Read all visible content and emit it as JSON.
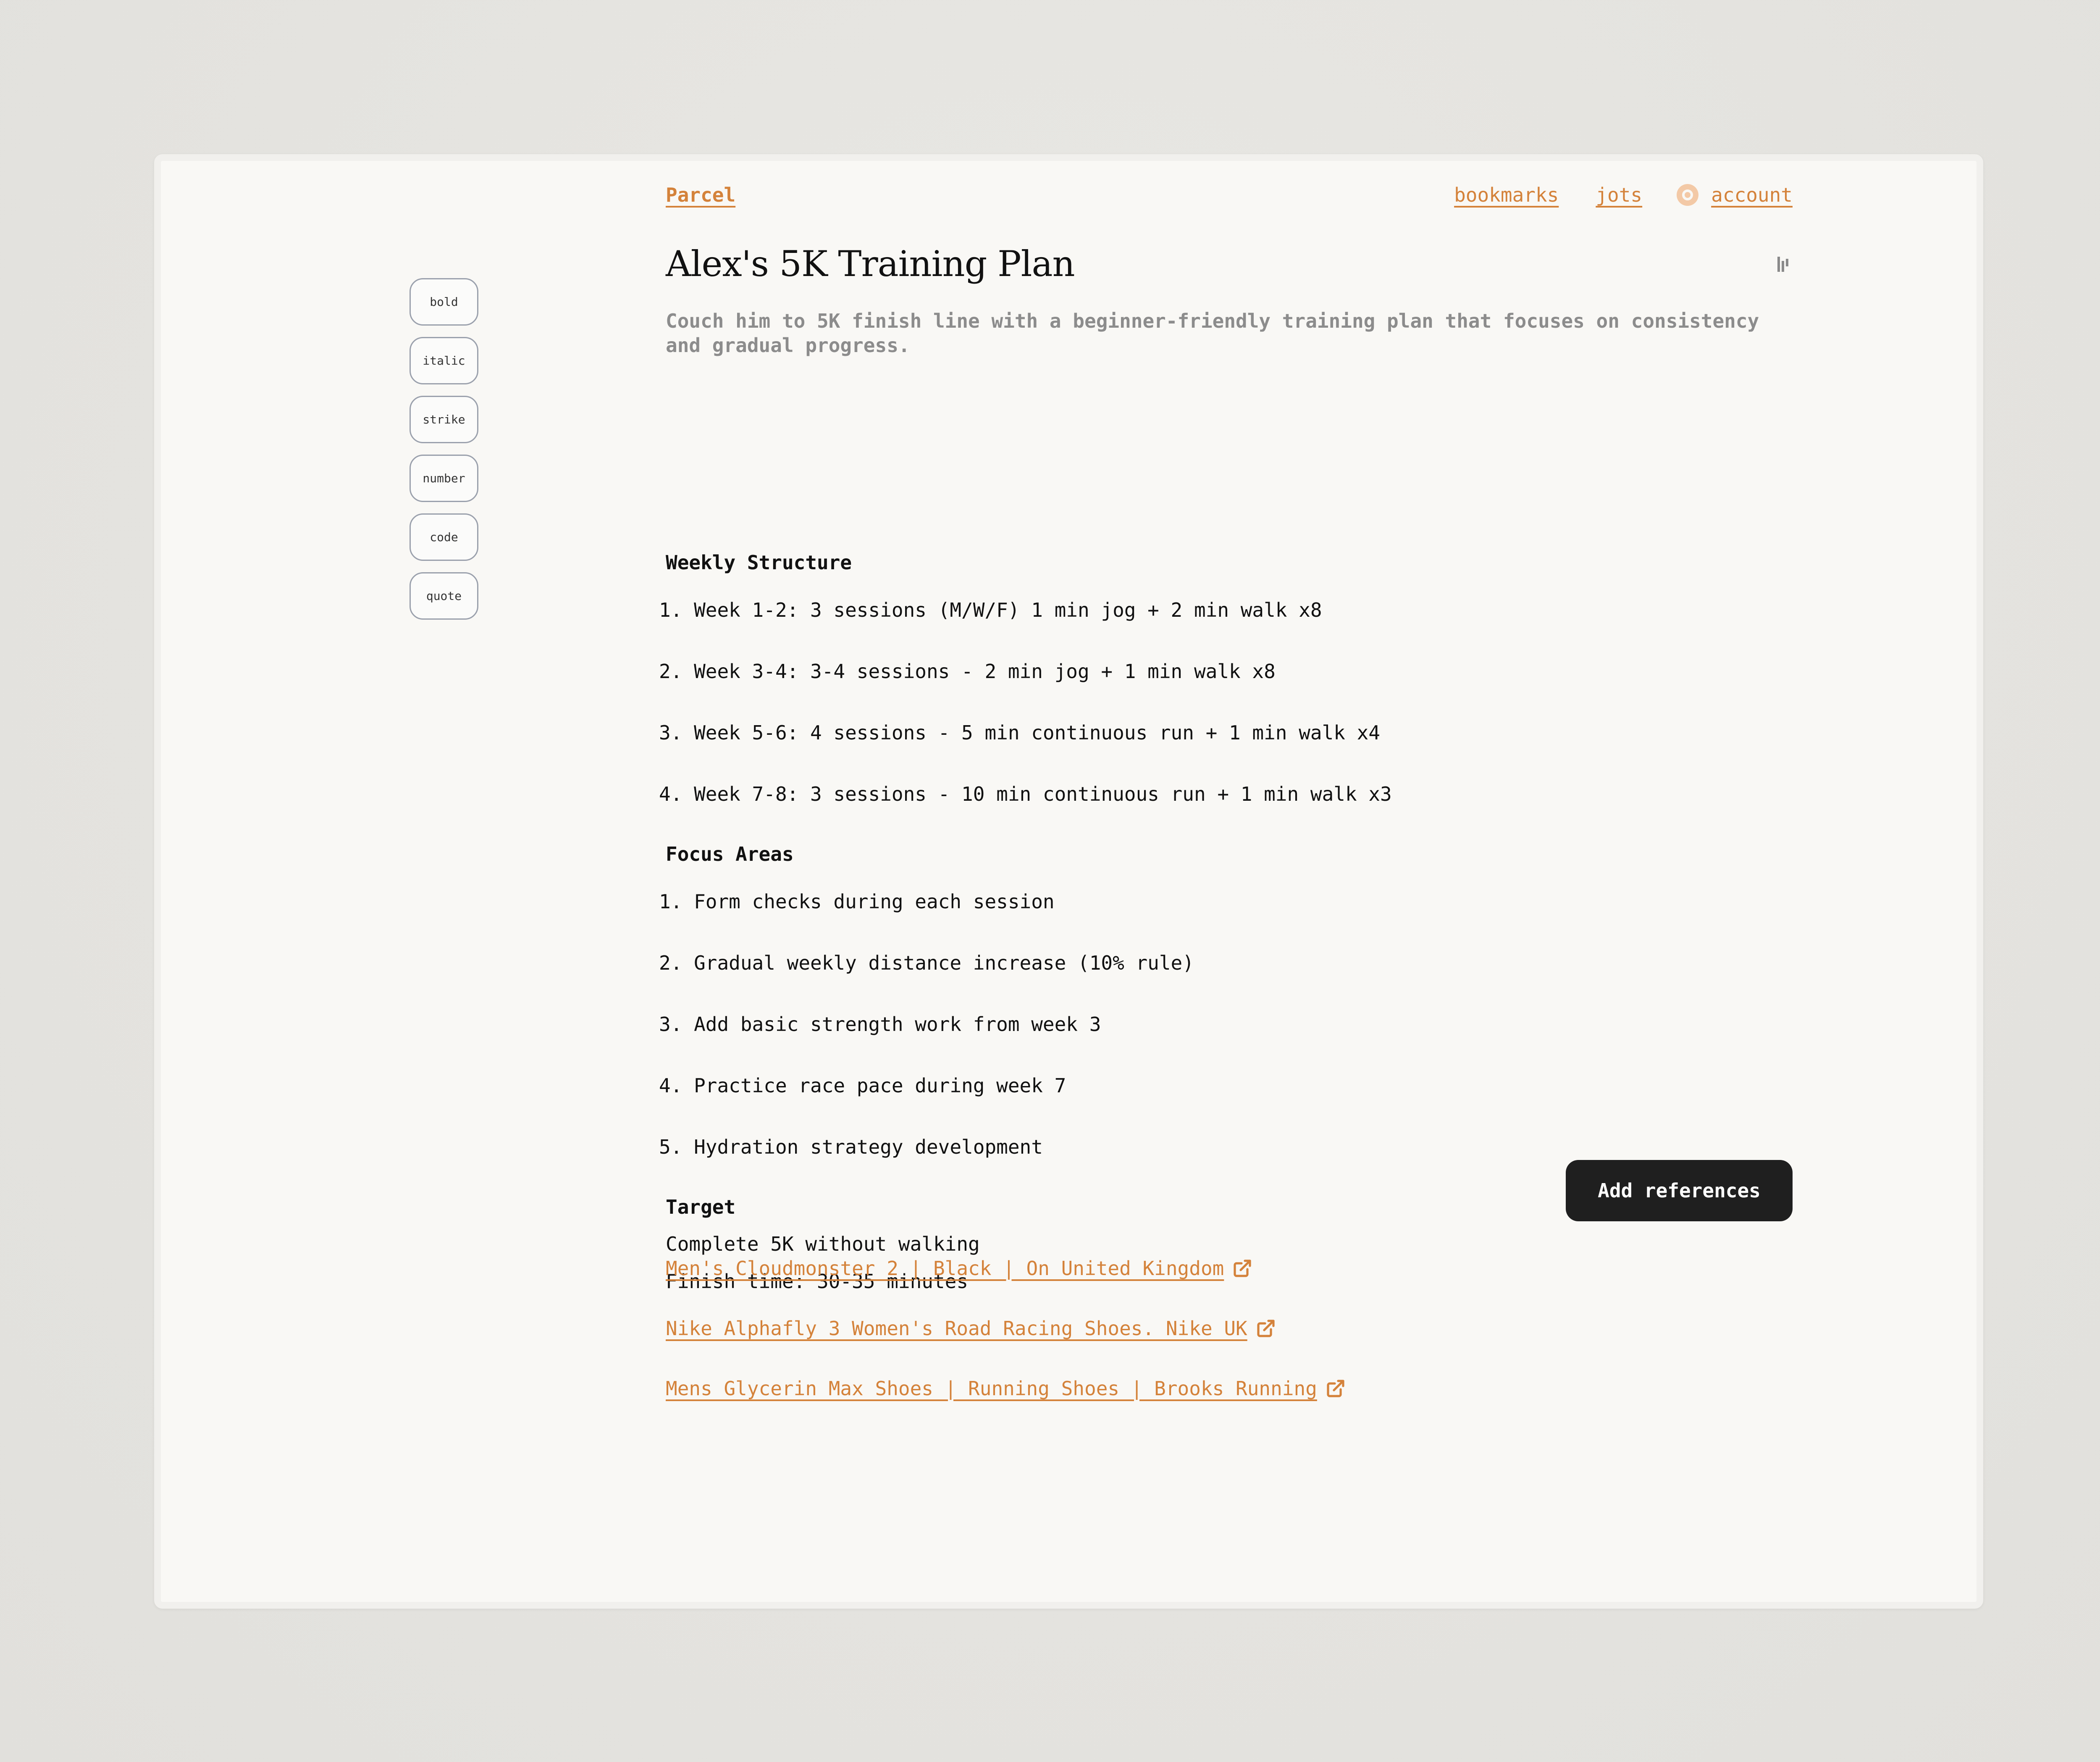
{
  "nav": {
    "brand": "Parcel",
    "bookmarks": "bookmarks",
    "jots": "jots",
    "account": "account"
  },
  "toolbar": [
    "bold",
    "italic",
    "strike",
    "number",
    "code",
    "quote"
  ],
  "note": {
    "title": "Alex's 5K Training Plan",
    "subtitle": "Couch him to 5K finish line with a beginner-friendly training plan that focuses on consistency and gradual progress.",
    "weekly_heading": "Weekly Structure",
    "weekly": [
      "1. Week 1-2: 3 sessions (M/W/F) 1 min jog + 2 min walk x8",
      "2. Week 3-4: 3-4 sessions - 2 min jog + 1 min walk x8",
      "3. Week 5-6: 4 sessions - 5 min continuous run + 1 min walk x4",
      "4. Week 7-8: 3 sessions - 10 min continuous run + 1 min walk x3"
    ],
    "focus_heading": "Focus Areas",
    "focus": [
      "1. Form checks during each session",
      "2. Gradual weekly distance increase (10% rule)",
      "3. Add basic strength work from week 3",
      "4. Practice race pace during week 7",
      "5. Hydration strategy development"
    ],
    "target_heading": "Target",
    "target_lines": [
      "Complete 5K without walking",
      "Finish time: 30-35 minutes"
    ]
  },
  "add_references_label": "Add references",
  "references": [
    "Men's Cloudmonster 2 | Black | On United Kingdom",
    "Nike Alphafly 3 Women's Road Racing Shoes. Nike UK",
    "Mens Glycerin Max Shoes | Running Shoes | Brooks Running"
  ],
  "colors": {
    "accent": "#d4823a",
    "button": "#1f1f1f",
    "page": "#f9f8f5"
  }
}
